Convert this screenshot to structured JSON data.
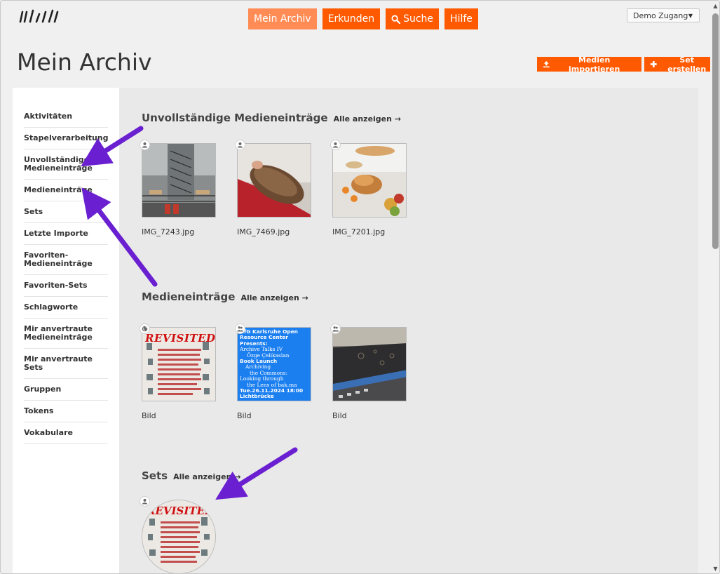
{
  "header": {
    "nav": [
      {
        "label": "Mein Archiv",
        "active": true
      },
      {
        "label": "Erkunden"
      },
      {
        "label": "Suche",
        "icon": "search-icon"
      },
      {
        "label": "Hilfe"
      }
    ],
    "account_label": "Demo Zugang",
    "account_caret": "▼"
  },
  "page": {
    "title": "Mein Archiv",
    "import_label": "Medien importieren",
    "create_set_label": "Set erstellen"
  },
  "sidebar": {
    "items": [
      "Aktivitäten",
      "Stapelverarbeitung",
      "Unvollständige Medieneinträge",
      "Medieneinträge",
      "Sets",
      "Letzte Importe",
      "Favoriten-Medieneinträge",
      "Favoriten-Sets",
      "Schlagworte",
      "Mir anvertraute Medieneinträge",
      "Mir anvertraute Sets",
      "Gruppen",
      "Tokens",
      "Vokabulare"
    ]
  },
  "sections": {
    "incomplete": {
      "title": "Unvollständige Medieneinträge",
      "show_all": "Alle anzeigen →",
      "items": [
        {
          "caption": "IMG_7243.jpg",
          "badge": "user-icon"
        },
        {
          "caption": "IMG_7469.jpg",
          "badge": "user-icon"
        },
        {
          "caption": "IMG_7201.jpg",
          "badge": "user-icon"
        }
      ]
    },
    "media": {
      "title": "Medieneinträge",
      "show_all": "Alle anzeigen →",
      "items": [
        {
          "caption": "Bild",
          "badge": "globe-icon",
          "overlay": "REVISITED"
        },
        {
          "caption": "Bild",
          "badge": "group-icon",
          "poster_lines": [
            "HfG Karlsruhe Open",
            "Resource Center",
            "Presents:",
            "Archive Talks IV",
            "Özge Çelikaslan",
            "Book Launch",
            "Archiving",
            "the Commons:",
            "Looking through",
            "the Lens of bak.ma",
            "Tue.26.11.2024 18:00",
            "Lichtbrücke"
          ]
        },
        {
          "caption": "Bild",
          "badge": "group-icon"
        }
      ]
    },
    "sets": {
      "title": "Sets",
      "show_all": "Alle anzeigen →",
      "items": [
        {
          "badge": "user-icon",
          "overlay": "REVISITED"
        }
      ]
    }
  },
  "colors": {
    "accent": "#ff5a00",
    "accent_active": "#ff8c55",
    "annotation_arrow": "#6a1fd0"
  }
}
